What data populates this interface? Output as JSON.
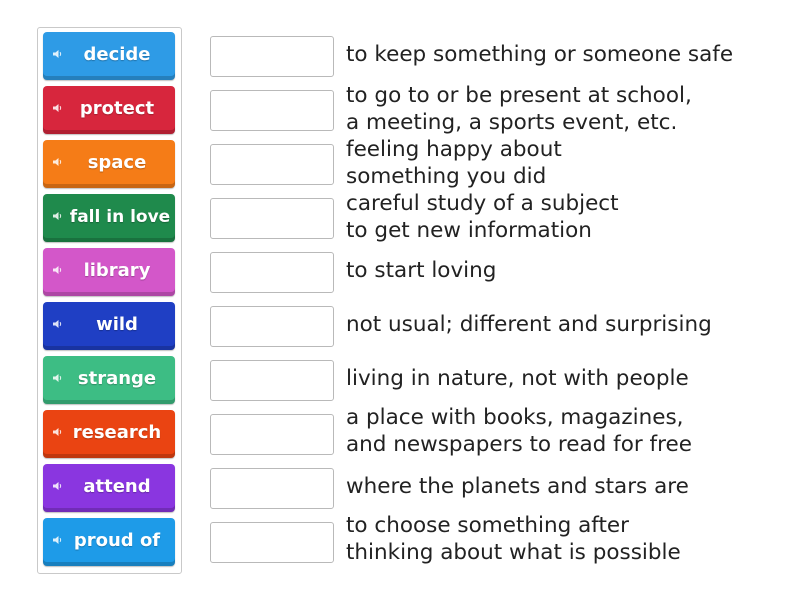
{
  "colors": {
    "blue": "#2e9be6",
    "red": "#d7263d",
    "orange": "#f57c17",
    "dark_green": "#1f8a4c",
    "pink": "#d357c9",
    "navy": "#1f3fc4",
    "mint": "#3dbd84",
    "red_orange": "#ea4412",
    "purple": "#8a36e0",
    "sky": "#1e9be8"
  },
  "tiles": [
    {
      "label": "decide",
      "color": "#2e9be6"
    },
    {
      "label": "protect",
      "color": "#d7263d"
    },
    {
      "label": "space",
      "color": "#f57c17"
    },
    {
      "label": "fall in love",
      "color": "#1f8a4c"
    },
    {
      "label": "library",
      "color": "#d357c9"
    },
    {
      "label": "wild",
      "color": "#1f3fc4"
    },
    {
      "label": "strange",
      "color": "#3dbd84"
    },
    {
      "label": "research",
      "color": "#ea4412"
    },
    {
      "label": "attend",
      "color": "#8a36e0"
    },
    {
      "label": "proud of",
      "color": "#1e9be8"
    }
  ],
  "definitions": [
    {
      "lines": [
        "to keep something or someone safe"
      ]
    },
    {
      "lines": [
        "to go to or be present at school,",
        "a meeting, a sports event, etc."
      ]
    },
    {
      "lines": [
        "feeling happy about",
        "something you did"
      ]
    },
    {
      "lines": [
        "careful study of a subject",
        "to get new information"
      ]
    },
    {
      "lines": [
        "to start loving"
      ]
    },
    {
      "lines": [
        "not usual; different and surprising"
      ]
    },
    {
      "lines": [
        "living in nature, not with people"
      ]
    },
    {
      "lines": [
        "a place with books, magazines,",
        "and newspapers to read for free"
      ]
    },
    {
      "lines": [
        "where the planets and stars are"
      ]
    },
    {
      "lines": [
        "to choose something after",
        "thinking about what is possible"
      ]
    }
  ]
}
